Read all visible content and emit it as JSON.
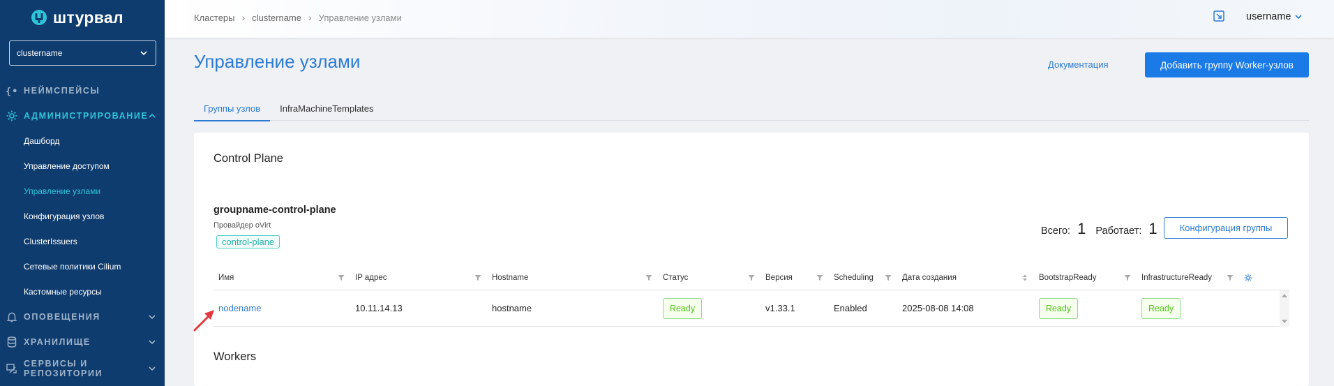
{
  "sidebar": {
    "logo_text": "штурвал",
    "cluster_select": "clustername",
    "sections": [
      {
        "label": "Неймспейсы",
        "icon": "braces-icon",
        "active": false
      },
      {
        "label": "Администрирование",
        "icon": "gear-icon",
        "active": true,
        "items": [
          {
            "label": "Дашборд",
            "active": false
          },
          {
            "label": "Управление доступом",
            "active": false
          },
          {
            "label": "Управление узлами",
            "active": true
          },
          {
            "label": "Конфигурация узлов",
            "active": false
          },
          {
            "label": "ClusterIssuers",
            "active": false
          },
          {
            "label": "Сетевые политики Cilium",
            "active": false
          },
          {
            "label": "Кастомные ресурсы",
            "active": false
          }
        ]
      },
      {
        "label": "Оповещения",
        "icon": "bell-icon",
        "active": false
      },
      {
        "label": "Хранилище",
        "icon": "database-icon",
        "active": false
      },
      {
        "label": "Сервисы и репозитории",
        "icon": "services-icon",
        "active": false
      }
    ]
  },
  "header": {
    "breadcrumb": [
      "Кластеры",
      "clustername",
      "Управление узлами"
    ],
    "username": "username"
  },
  "main": {
    "title": "Управление узлами",
    "doc_link": "Документация",
    "add_button": "Добавить группу Worker-узлов",
    "tabs": [
      {
        "label": "Группы узлов",
        "active": true
      },
      {
        "label": "InfraMachineTemplates",
        "active": false
      }
    ],
    "control_plane": {
      "section_title": "Control Plane",
      "group_name": "groupname-control-plane",
      "provider": "Провайдер oVirt",
      "tag": "control-plane",
      "total_label": "Всего:",
      "total": "1",
      "running_label": "Работает:",
      "running": "1",
      "config_button": "Конфигурация группы",
      "columns": [
        "Имя",
        "IP адрес",
        "Hostname",
        "Статус",
        "Версия",
        "Scheduling",
        "Дата создания",
        "BootstrapReady",
        "InfrastructureReady"
      ],
      "rows": [
        {
          "name": "nodename",
          "ip": "10.11.14.13",
          "hostname": "hostname",
          "status": "Ready",
          "version": "v1.33.1",
          "scheduling": "Enabled",
          "created": "2025-08-08 14:08",
          "bootstrap": "Ready",
          "infra": "Ready"
        }
      ]
    },
    "workers": {
      "section_title": "Workers"
    }
  },
  "colors": {
    "sidebar_bg": "#0f3c6e",
    "accent": "#2b7bd4",
    "sidebar_active": "#2ec4d8",
    "ready_green": "#52c41a",
    "tag_teal": "#4fd1c5",
    "annotation_arrow": "#e0393e"
  }
}
